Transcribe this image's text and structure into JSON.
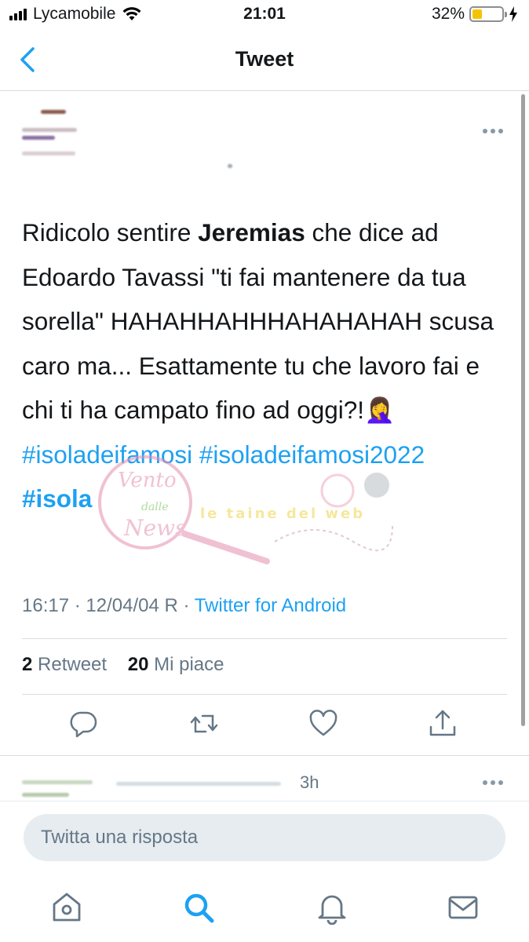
{
  "status_bar": {
    "carrier": "Lycamobile",
    "time": "21:01",
    "battery_percent": "32%",
    "battery_level": 0.32,
    "battery_color": "#f5c400"
  },
  "nav": {
    "title": "Tweet",
    "back_icon": "chevron-left-icon",
    "accent": "#1da1f2"
  },
  "tweet": {
    "text_parts": {
      "before_bold": "Ridicolo sentire ",
      "bold": "Jeremias",
      "after_bold": " che dice ad Edoardo Tavassi \"ti fai mantenere da tua sorella\" HAHAHHAHHHAHAHAHAH scusa caro ma... Esattamente tu che lavoro fai e chi ti ha campato fino ad oggi?!",
      "emoji": "🤦‍♀️"
    },
    "hashtags": [
      "#isoladeifamosi",
      "#isoladeifamosi2022",
      "#isola"
    ],
    "timestamp": "16:17 · 12/04/04 R · ",
    "client": "Twitter for Android",
    "retweets_count": "2",
    "retweets_label": " Retweet",
    "likes_count": "20",
    "likes_label": " Mi piace"
  },
  "watermark": {
    "brand_lines": [
      "Vento",
      "dalle",
      "News"
    ],
    "brand_tagline": "le taine del web"
  },
  "actions": [
    "reply-icon",
    "retweet-icon",
    "like-icon",
    "share-icon"
  ],
  "reply_preview": {
    "time": "3h"
  },
  "composer": {
    "placeholder": "Twitta una risposta"
  },
  "tab_bar": [
    "home-icon",
    "search-icon",
    "notifications-icon",
    "messages-icon"
  ]
}
